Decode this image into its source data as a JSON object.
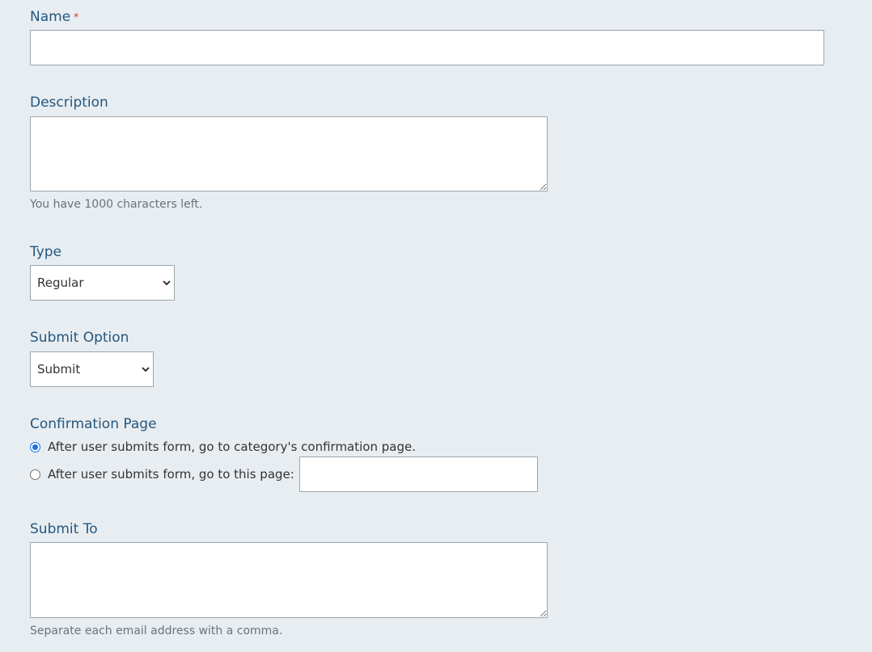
{
  "fields": {
    "name": {
      "label": "Name",
      "required_mark": "*",
      "value": ""
    },
    "description": {
      "label": "Description",
      "value": "",
      "help": "You have 1000 characters left."
    },
    "type": {
      "label": "Type",
      "selected": "Regular"
    },
    "submit_option": {
      "label": "Submit Option",
      "selected": "Submit"
    },
    "confirmation_page": {
      "label": "Confirmation Page",
      "options": [
        {
          "label": "After user submits form, go to category's confirmation page.",
          "checked": true
        },
        {
          "label": "After user submits form, go to this page:",
          "checked": false
        }
      ],
      "custom_page_value": ""
    },
    "submit_to": {
      "label": "Submit To",
      "value": "",
      "help": "Separate each email address with a comma."
    }
  },
  "colors": {
    "background": "#e8edf1",
    "label": "#24577f",
    "help_text": "#6c7378",
    "required": "#c0392b",
    "radio_accent": "#1a73e8"
  },
  "icons": {
    "select_arrow": "chevron-down-icon"
  }
}
